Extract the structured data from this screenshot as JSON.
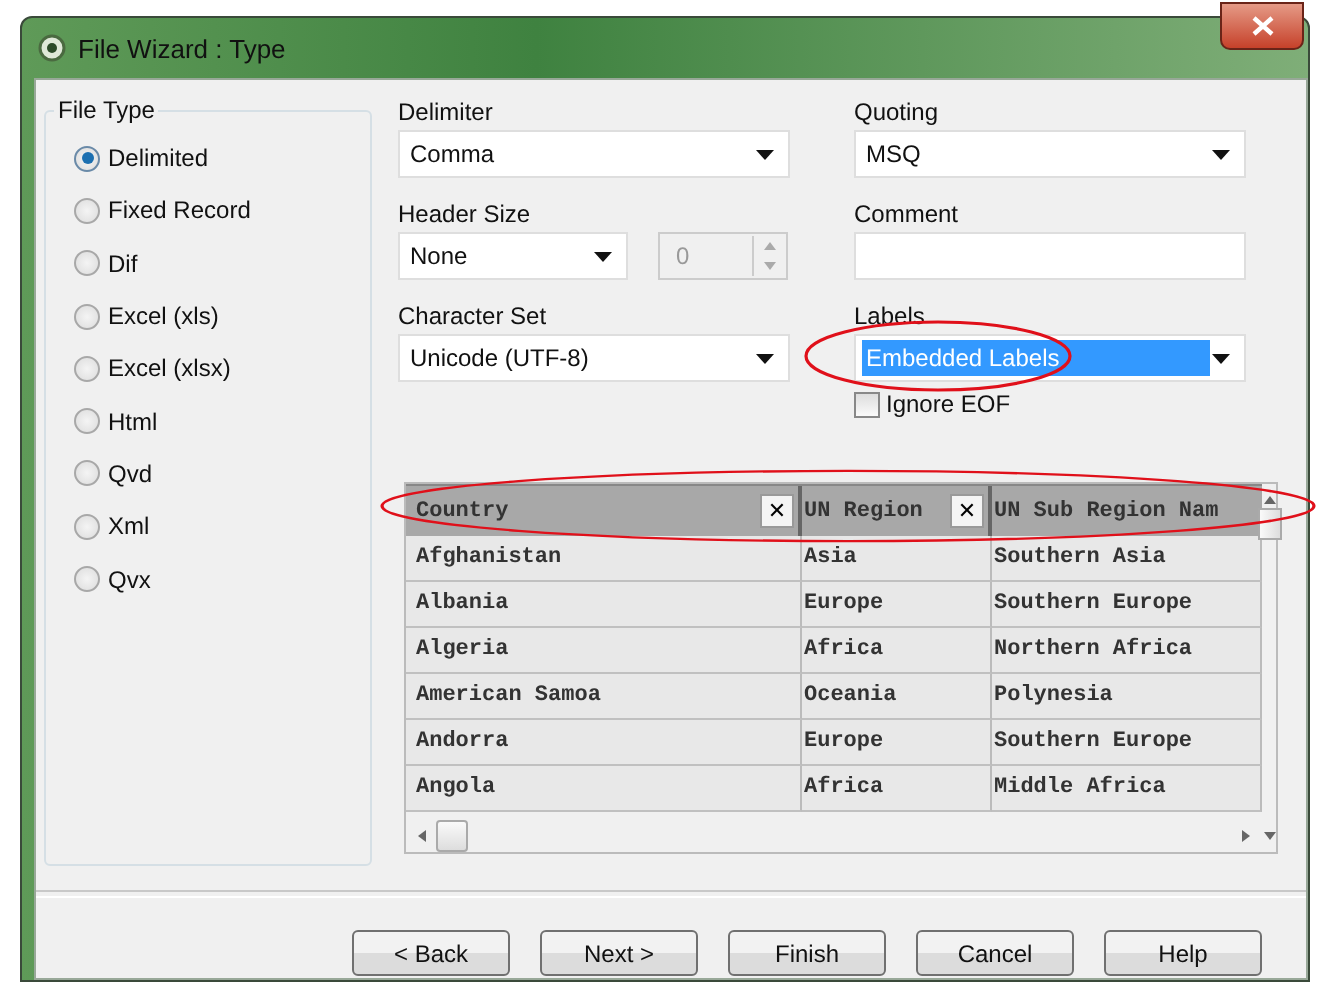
{
  "window": {
    "title": "File Wizard : Type"
  },
  "file_type": {
    "title": "File Type",
    "options": [
      {
        "label": "Delimited",
        "selected": true
      },
      {
        "label": "Fixed Record",
        "selected": false
      },
      {
        "label": "Dif",
        "selected": false
      },
      {
        "label": "Excel (xls)",
        "selected": false
      },
      {
        "label": "Excel (xlsx)",
        "selected": false
      },
      {
        "label": "Html",
        "selected": false
      },
      {
        "label": "Qvd",
        "selected": false
      },
      {
        "label": "Xml",
        "selected": false
      },
      {
        "label": "Qvx",
        "selected": false
      }
    ]
  },
  "delimiter": {
    "label": "Delimiter",
    "value": "Comma"
  },
  "quoting": {
    "label": "Quoting",
    "value": "MSQ"
  },
  "header_size": {
    "label": "Header Size",
    "value": "None",
    "spinner_value": "0"
  },
  "comment": {
    "label": "Comment"
  },
  "character_set": {
    "label": "Character Set",
    "value": "Unicode (UTF-8)"
  },
  "labels": {
    "label": "Labels",
    "value": "Embedded Labels",
    "circled": true
  },
  "ignore_eof": {
    "label": "Ignore EOF",
    "checked": false
  },
  "table": {
    "header_circled": true,
    "columns": [
      {
        "label": "Country",
        "close": "✕"
      },
      {
        "label": "UN Region",
        "close": "✕"
      },
      {
        "label": "UN Sub Region Nam"
      }
    ],
    "rows": [
      [
        "Afghanistan",
        "Asia",
        "Southern Asia"
      ],
      [
        "Albania",
        "Europe",
        "Southern Europe"
      ],
      [
        "Algeria",
        "Africa",
        "Northern Africa"
      ],
      [
        "American Samoa",
        "Oceania",
        "Polynesia"
      ],
      [
        "Andorra",
        "Europe",
        "Southern Europe"
      ],
      [
        "Angola",
        "Africa",
        "Middle Africa"
      ]
    ]
  },
  "buttons": [
    "< Back",
    "Next >",
    "Finish",
    "Cancel",
    "Help"
  ]
}
